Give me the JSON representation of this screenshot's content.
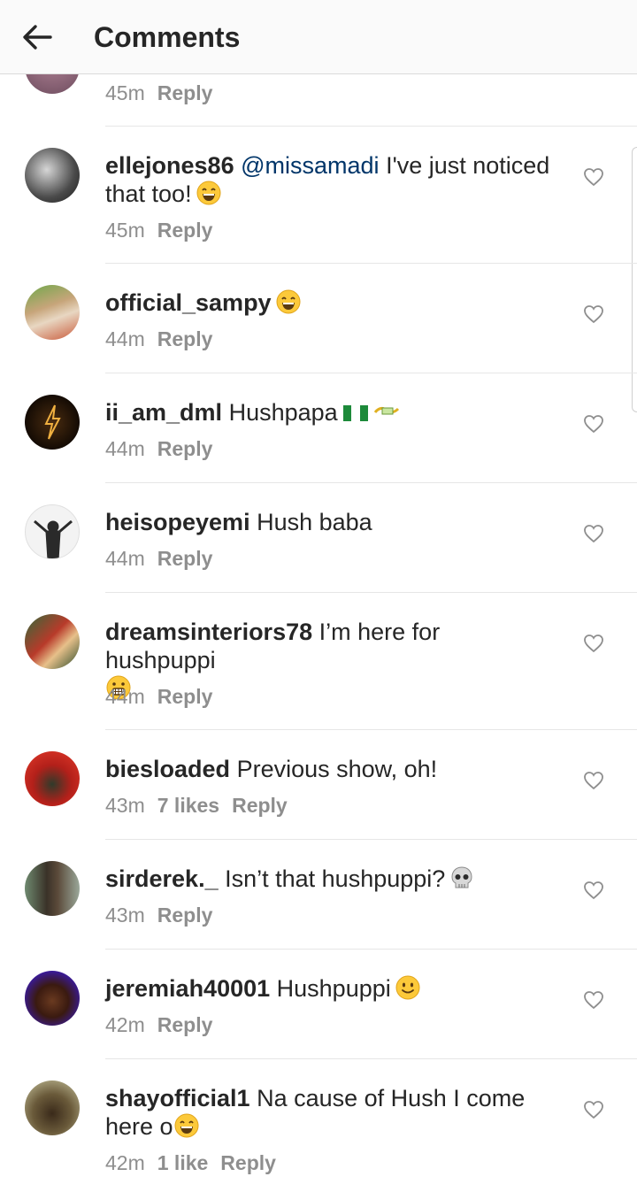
{
  "header": {
    "title": "Comments"
  },
  "comments": [
    {
      "username": "",
      "text": "",
      "time": "45m",
      "reply": "Reply"
    },
    {
      "username": "ellejones86",
      "mention": "@missamadi",
      "text": "I've just noticed that too!",
      "emoji": "laughing-emoji",
      "time": "45m",
      "reply": "Reply"
    },
    {
      "username": "official_sampy",
      "text": "",
      "emoji": "laughing-emoji",
      "time": "44m",
      "reply": "Reply"
    },
    {
      "username": "ii_am_dml",
      "text": "Hushpapa",
      "emoji": "nigeria-flag + flying-money",
      "time": "44m",
      "reply": "Reply"
    },
    {
      "username": "heisopeyemi",
      "text": "Hush baba",
      "time": "44m",
      "reply": "Reply"
    },
    {
      "username": "dreamsinteriors78",
      "text": "I’m here for hushpuppi",
      "emoji": "grimacing-emoji",
      "time": "44m",
      "reply": "Reply"
    },
    {
      "username": "biesloaded",
      "text": "Previous show, oh!",
      "time": "43m",
      "likes": "7 likes",
      "reply": "Reply"
    },
    {
      "username": "sirderek._",
      "text": "Isn’t that hushpuppi?",
      "emoji": "skull-emoji",
      "time": "43m",
      "reply": "Reply"
    },
    {
      "username": "jeremiah40001",
      "text": "Hushpuppi",
      "emoji": "smiling-emoji",
      "time": "42m",
      "reply": "Reply"
    },
    {
      "username": "shayofficial1",
      "text": "Na cause of Hush I come here o",
      "emoji": "laughing-emoji",
      "time": "42m",
      "likes": "1 like",
      "reply": "Reply"
    }
  ],
  "colors": {
    "text": "#262626",
    "meta": "#8e8e8e",
    "mention": "#003569",
    "topbar_bg": "#fafafa"
  }
}
